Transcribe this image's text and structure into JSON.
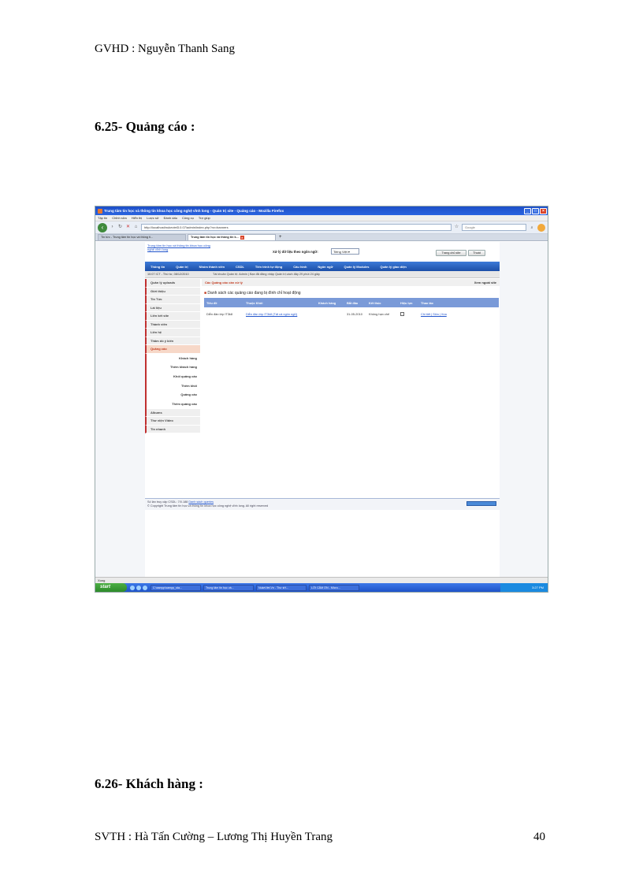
{
  "header": "GVHD : Nguyễn Thanh Sang",
  "headings": {
    "quangcao": "6.25- Quảng cáo :",
    "khachhang": "6.26- Khách hàng :"
  },
  "footer": {
    "authors": "SVTH : Hà Tấn Cường – Lương Thị Huyền Trang",
    "page": "40"
  },
  "screenshot": {
    "window_title": "Trung tâm tin học và thông tin khoa học công nghệ vĩnh long - Quản trị site - Quảng cáo - Mozilla Firefox",
    "menu": [
      "Tập tin",
      "Chỉnh sửa",
      "Hiển thị",
      "Lược sử",
      "Đánh dấu",
      "Công cụ",
      "Trợ giúp"
    ],
    "url": "http://localhost/nukeviet3.0.07/admin/index.php?nv=banners",
    "search_placeholder": "Google",
    "tabs": [
      "Tin tức - Trung tâm tin học và thông ti...",
      "Trung tâm tin học và thông tin k..."
    ],
    "site": {
      "logo_text": "Trung tâm tin học và thông tin khoa học công nghệ vĩnh long",
      "lang_label": "Xử lý dữ liệu theo ngôn ngữ:",
      "lang_value": "Tiếng Việt",
      "btn_home": "Trang chủ site",
      "btn_logout": "Thoát",
      "nav": [
        "Thông tin",
        "Quản trị",
        "Nhóm thành viên",
        "CSDL",
        "Tiến trình tự động",
        "Cấu hình",
        "Ngôn ngữ",
        "Quản lý Modules",
        "Quản lý giao diện"
      ],
      "clock": "10:07 ICT - Thứ tư, 08/12/2010",
      "login_info": "Tài khoản Quản trị: Admin | Bạn đã đăng nhập Quản trị cách đây 29 phút 24 giây",
      "sidebar": [
        "Quản lý uploads",
        "Giới thiệu",
        "Tin Tức",
        "Lài liệu",
        "Liên kết site",
        "Thành viên",
        "Liên hệ",
        "Thăm dò ý kiến",
        "Quảng cáo"
      ],
      "sidebar_sub": [
        "Khách hàng",
        "Thêm khách hàng",
        "Khối quảng cáo",
        "Thêm khối",
        "Quảng cáo",
        "Thêm quảng cáo"
      ],
      "sidebar_after": [
        "Albums",
        "Thư viện Video",
        "Tin nhanh"
      ],
      "crumb": "Các Quảng cáo cần xử lý",
      "view_site": "Xem ngoài site",
      "list_title": "Danh sách các quảng cáo đang bị đình chỉ hoạt động",
      "table": {
        "headers": [
          "Tiêu đề",
          "Thuộc Khối",
          "Khách hàng",
          "Bắt đầu",
          "Kết thúc",
          "Hiệu lực",
          "Thao tác"
        ],
        "rows": [
          {
            "title": "Diễn đàn lớp IT3k8",
            "block": "Diễn đàn lớp IT3k8 (Tất cả ngôn ngữ)",
            "client": "",
            "start": "31-05-2010",
            "end": "Không hạn chế",
            "actions": "Chi tiết | Sửa | Xóa"
          }
        ]
      },
      "footer_line1": "Số lần truy cập CSDL: 7/0.188",
      "footer_link": "Danh sách queries",
      "footer_line2": "© Copyright Trung tâm tin học và thông tin khoa học công nghệ vĩnh long. All right reserved"
    },
    "status": "Xong",
    "taskbar": {
      "start": "start",
      "tasks": [
        "C:\\xampp\\xampp_sta...",
        "Trung tâm tin học và...",
        "NukeViet.Vn - Thư sH...",
        "LỜI CẢM ƠN - Micro..."
      ],
      "clock": "3:27 PM"
    }
  }
}
